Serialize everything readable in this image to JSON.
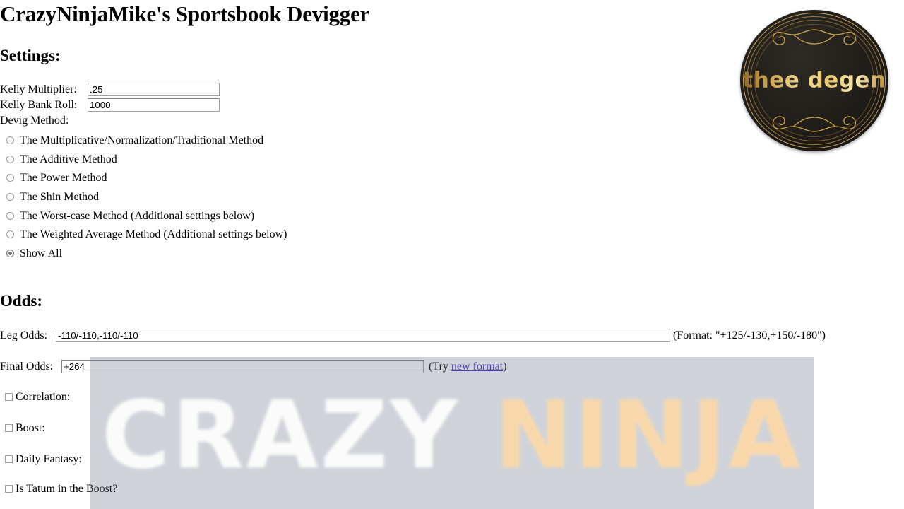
{
  "page": {
    "title": "CrazyNinjaMike's Sportsbook Devigger"
  },
  "settings": {
    "heading": "Settings:",
    "kelly_multiplier": {
      "label": "Kelly Multiplier:",
      "value": ".25"
    },
    "kelly_bank_roll": {
      "label": "Kelly Bank Roll:",
      "value": "1000"
    },
    "devig_method_label": "Devig Method:",
    "devig_methods": [
      {
        "label": "The Multiplicative/Normalization/Traditional Method",
        "selected": false
      },
      {
        "label": "The Additive Method",
        "selected": false
      },
      {
        "label": "The Power Method",
        "selected": false
      },
      {
        "label": "The Shin Method",
        "selected": false
      },
      {
        "label": "The Worst-case Method (Additional settings below)",
        "selected": false
      },
      {
        "label": "The Weighted Average Method (Additional settings below)",
        "selected": false
      },
      {
        "label": "Show All",
        "selected": true
      }
    ]
  },
  "odds": {
    "heading": "Odds:",
    "leg_odds": {
      "label": "Leg Odds:",
      "value": "-110/-110,-110/-110",
      "hint": "(Format: \"+125/-130,+150/-180\")"
    },
    "final_odds": {
      "label": "Final Odds:",
      "value": "+264",
      "hint_prefix": "(Try ",
      "hint_link": "new format",
      "hint_suffix": ")"
    },
    "options": [
      {
        "label": "Correlation:",
        "checked": false
      },
      {
        "label": "Boost:",
        "checked": false
      },
      {
        "label": "Daily Fantasy:",
        "checked": false
      },
      {
        "label": "Is Tatum in the Boost?",
        "checked": false
      }
    ]
  },
  "watermark": {
    "word_one": "CRAZY",
    "word_two": "NINJA"
  },
  "logo": {
    "text": "thee degen"
  },
  "colors": {
    "link": "#3c26c8",
    "watermark_gray": "#adb2bb",
    "watermark_crazy": "#ffffff",
    "watermark_ninja": "#fcd9a8",
    "logo_gold": "#e8c86b",
    "logo_background": "#1c1916"
  }
}
